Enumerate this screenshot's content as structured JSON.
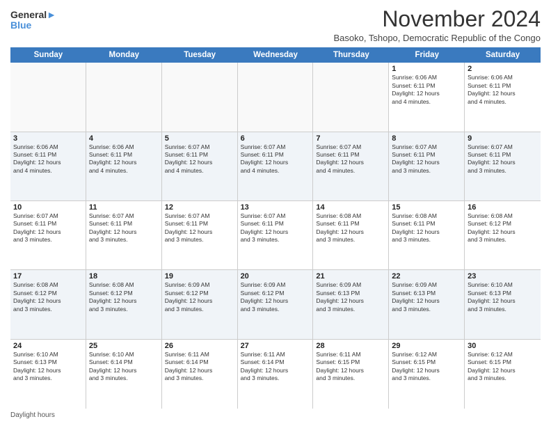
{
  "logo": {
    "line1": "General",
    "line2": "Blue"
  },
  "title": "November 2024",
  "subtitle": "Basoko, Tshopo, Democratic Republic of the Congo",
  "headers": [
    "Sunday",
    "Monday",
    "Tuesday",
    "Wednesday",
    "Thursday",
    "Friday",
    "Saturday"
  ],
  "footer": "Daylight hours",
  "weeks": [
    [
      {
        "day": "",
        "info": ""
      },
      {
        "day": "",
        "info": ""
      },
      {
        "day": "",
        "info": ""
      },
      {
        "day": "",
        "info": ""
      },
      {
        "day": "",
        "info": ""
      },
      {
        "day": "1",
        "info": "Sunrise: 6:06 AM\nSunset: 6:11 PM\nDaylight: 12 hours\nand 4 minutes."
      },
      {
        "day": "2",
        "info": "Sunrise: 6:06 AM\nSunset: 6:11 PM\nDaylight: 12 hours\nand 4 minutes."
      }
    ],
    [
      {
        "day": "3",
        "info": "Sunrise: 6:06 AM\nSunset: 6:11 PM\nDaylight: 12 hours\nand 4 minutes."
      },
      {
        "day": "4",
        "info": "Sunrise: 6:06 AM\nSunset: 6:11 PM\nDaylight: 12 hours\nand 4 minutes."
      },
      {
        "day": "5",
        "info": "Sunrise: 6:07 AM\nSunset: 6:11 PM\nDaylight: 12 hours\nand 4 minutes."
      },
      {
        "day": "6",
        "info": "Sunrise: 6:07 AM\nSunset: 6:11 PM\nDaylight: 12 hours\nand 4 minutes."
      },
      {
        "day": "7",
        "info": "Sunrise: 6:07 AM\nSunset: 6:11 PM\nDaylight: 12 hours\nand 4 minutes."
      },
      {
        "day": "8",
        "info": "Sunrise: 6:07 AM\nSunset: 6:11 PM\nDaylight: 12 hours\nand 3 minutes."
      },
      {
        "day": "9",
        "info": "Sunrise: 6:07 AM\nSunset: 6:11 PM\nDaylight: 12 hours\nand 3 minutes."
      }
    ],
    [
      {
        "day": "10",
        "info": "Sunrise: 6:07 AM\nSunset: 6:11 PM\nDaylight: 12 hours\nand 3 minutes."
      },
      {
        "day": "11",
        "info": "Sunrise: 6:07 AM\nSunset: 6:11 PM\nDaylight: 12 hours\nand 3 minutes."
      },
      {
        "day": "12",
        "info": "Sunrise: 6:07 AM\nSunset: 6:11 PM\nDaylight: 12 hours\nand 3 minutes."
      },
      {
        "day": "13",
        "info": "Sunrise: 6:07 AM\nSunset: 6:11 PM\nDaylight: 12 hours\nand 3 minutes."
      },
      {
        "day": "14",
        "info": "Sunrise: 6:08 AM\nSunset: 6:11 PM\nDaylight: 12 hours\nand 3 minutes."
      },
      {
        "day": "15",
        "info": "Sunrise: 6:08 AM\nSunset: 6:11 PM\nDaylight: 12 hours\nand 3 minutes."
      },
      {
        "day": "16",
        "info": "Sunrise: 6:08 AM\nSunset: 6:12 PM\nDaylight: 12 hours\nand 3 minutes."
      }
    ],
    [
      {
        "day": "17",
        "info": "Sunrise: 6:08 AM\nSunset: 6:12 PM\nDaylight: 12 hours\nand 3 minutes."
      },
      {
        "day": "18",
        "info": "Sunrise: 6:08 AM\nSunset: 6:12 PM\nDaylight: 12 hours\nand 3 minutes."
      },
      {
        "day": "19",
        "info": "Sunrise: 6:09 AM\nSunset: 6:12 PM\nDaylight: 12 hours\nand 3 minutes."
      },
      {
        "day": "20",
        "info": "Sunrise: 6:09 AM\nSunset: 6:12 PM\nDaylight: 12 hours\nand 3 minutes."
      },
      {
        "day": "21",
        "info": "Sunrise: 6:09 AM\nSunset: 6:13 PM\nDaylight: 12 hours\nand 3 minutes."
      },
      {
        "day": "22",
        "info": "Sunrise: 6:09 AM\nSunset: 6:13 PM\nDaylight: 12 hours\nand 3 minutes."
      },
      {
        "day": "23",
        "info": "Sunrise: 6:10 AM\nSunset: 6:13 PM\nDaylight: 12 hours\nand 3 minutes."
      }
    ],
    [
      {
        "day": "24",
        "info": "Sunrise: 6:10 AM\nSunset: 6:13 PM\nDaylight: 12 hours\nand 3 minutes."
      },
      {
        "day": "25",
        "info": "Sunrise: 6:10 AM\nSunset: 6:14 PM\nDaylight: 12 hours\nand 3 minutes."
      },
      {
        "day": "26",
        "info": "Sunrise: 6:11 AM\nSunset: 6:14 PM\nDaylight: 12 hours\nand 3 minutes."
      },
      {
        "day": "27",
        "info": "Sunrise: 6:11 AM\nSunset: 6:14 PM\nDaylight: 12 hours\nand 3 minutes."
      },
      {
        "day": "28",
        "info": "Sunrise: 6:11 AM\nSunset: 6:15 PM\nDaylight: 12 hours\nand 3 minutes."
      },
      {
        "day": "29",
        "info": "Sunrise: 6:12 AM\nSunset: 6:15 PM\nDaylight: 12 hours\nand 3 minutes."
      },
      {
        "day": "30",
        "info": "Sunrise: 6:12 AM\nSunset: 6:15 PM\nDaylight: 12 hours\nand 3 minutes."
      }
    ]
  ]
}
